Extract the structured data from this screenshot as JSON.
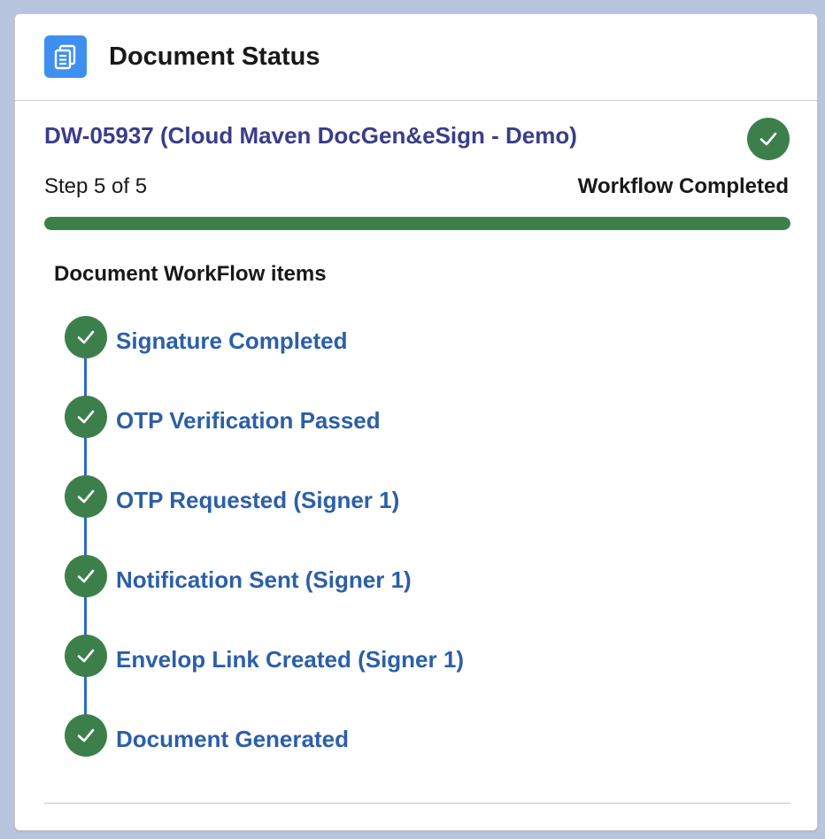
{
  "header": {
    "title": "Document Status",
    "icon": "document-copy-icon",
    "icon_color": "#3f8ff0"
  },
  "document": {
    "title": "DW-05937 (Cloud Maven DocGen&eSign - Demo)",
    "status_icon": "check-icon",
    "step_text": "Step 5 of 5",
    "status_text": "Workflow Completed",
    "progress": 1.0,
    "progress_color": "#3c7f4a"
  },
  "workflow": {
    "section_title": "Document WorkFlow items",
    "items": [
      {
        "label": "Signature Completed",
        "icon": "check-icon"
      },
      {
        "label": "OTP Verification Passed",
        "icon": "check-icon"
      },
      {
        "label": "OTP Requested (Signer 1)",
        "icon": "check-icon"
      },
      {
        "label": "Notification Sent (Signer 1)",
        "icon": "check-icon"
      },
      {
        "label": "Envelop Link Created (Signer 1)",
        "icon": "check-icon"
      },
      {
        "label": "Document Generated",
        "icon": "check-icon"
      }
    ]
  }
}
